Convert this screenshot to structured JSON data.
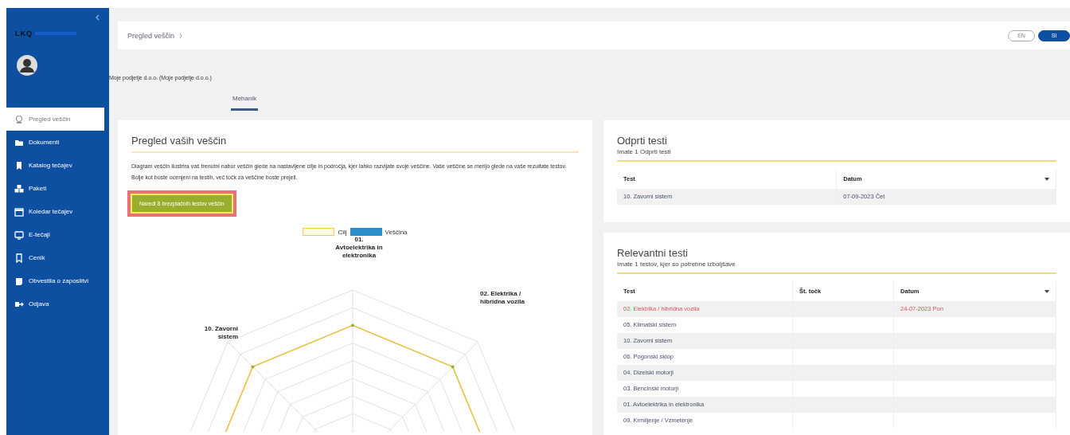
{
  "sidebar": {
    "logo": "LKQ",
    "items": [
      {
        "label": "Pregled veščin",
        "selected": true
      },
      {
        "label": "Dokumenti",
        "selected": false
      },
      {
        "label": "Katalog tečajev",
        "selected": false
      },
      {
        "label": "Paketi",
        "selected": false
      },
      {
        "label": "Koledar tečajev",
        "selected": false
      },
      {
        "label": "E-tečaji",
        "selected": false
      },
      {
        "label": "Cenik",
        "selected": false
      },
      {
        "label": "Obvestila o zaposlitvi",
        "selected": false
      },
      {
        "label": "Odjava",
        "selected": false
      }
    ]
  },
  "header": {
    "breadcrumb": "Pregled veščin",
    "languages": [
      {
        "label": "EN",
        "selected": false
      },
      {
        "label": "SI",
        "selected": true
      }
    ]
  },
  "company": "Moje podjetje d.o.o. (Moje podjetje d.o.o.)",
  "tabs": [
    {
      "label": "Mehanik",
      "selected": true
    }
  ],
  "skills": {
    "title": "Pregled vaših veščin",
    "description": "Diagram veščin ilustrira vaš trenutni nabor veščin glede na nastavljene cilje in področja, kjer lahko razvijate svoje veščine. Vaše veščine se merijo glede na vaše rezultate testov. Bolje kot boste ocenjeni na testih, več točk za veščine boste prejeli.",
    "button": "Naredi 8 brezplačnih testov veščin",
    "legend": [
      {
        "label": "Cilj",
        "color": "#f2c94c"
      },
      {
        "label": "Veščina",
        "color": "#2b8fc9"
      }
    ],
    "axis_labels": [
      "01. Avtoelektrika in elektronika",
      "02. Elektrika / hibridna vozila",
      "10. Zavorni sistem"
    ]
  },
  "open_tests": {
    "title": "Odprti testi",
    "subtitle": "Imate 1 Odprti testi",
    "columns": [
      "Test",
      "Datum"
    ],
    "rows": [
      {
        "cells": [
          "10. Zavorni sistem",
          "07-09-2023 Čet"
        ],
        "failed": false
      }
    ]
  },
  "relevant_tests": {
    "title": "Relevantni testi",
    "subtitle": "Imate 1 testov, kjer so potrebne izboljšave",
    "columns": [
      "Test",
      "Št. točk",
      "Datum"
    ],
    "rows": [
      {
        "cells": [
          "02. Elektrika / hibridna vozila",
          "",
          "24-07-2023 Pon"
        ],
        "failed": true
      },
      {
        "cells": [
          "05. Klimatski sistem",
          "",
          ""
        ],
        "failed": false
      },
      {
        "cells": [
          "10. Zavorni sistem",
          "",
          ""
        ],
        "failed": false
      },
      {
        "cells": [
          "06. Pogonski sklop",
          "",
          ""
        ],
        "failed": false
      },
      {
        "cells": [
          "04. Dizelski motorji",
          "",
          ""
        ],
        "failed": false
      },
      {
        "cells": [
          "03. Bencinski motorji",
          "",
          ""
        ],
        "failed": false
      },
      {
        "cells": [
          "01. Avtoelektrika in elektronika",
          "",
          ""
        ],
        "failed": false
      },
      {
        "cells": [
          "09. Krmiljenje / Vzmetenje",
          "",
          ""
        ],
        "failed": false
      }
    ]
  }
}
